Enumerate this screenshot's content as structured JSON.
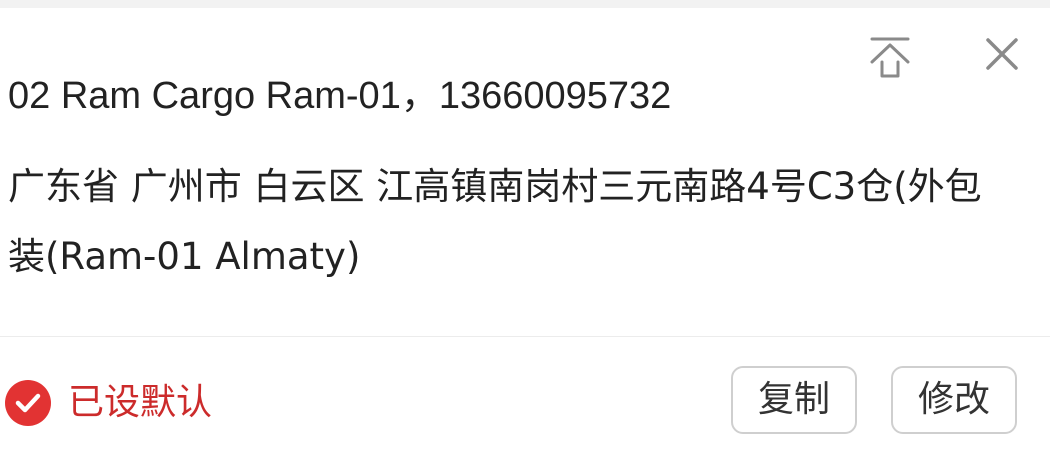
{
  "card": {
    "contact": "02 Ram Cargo Ram-01，13660095732",
    "address": "广东省 广州市 白云区 江高镇南岗村三元南路4号C3仓(外包装(Ram-01 Almaty)",
    "default_label": "已设默认",
    "copy_label": "复制",
    "edit_label": "修改"
  },
  "icons": {
    "pin_top": "pin-to-top-icon",
    "close": "close-icon",
    "default_check": "checkmark-icon"
  },
  "colors": {
    "accent_red": "#e23333",
    "default_text": "#cc2b2b",
    "icon_gray": "#8a8a8a"
  }
}
